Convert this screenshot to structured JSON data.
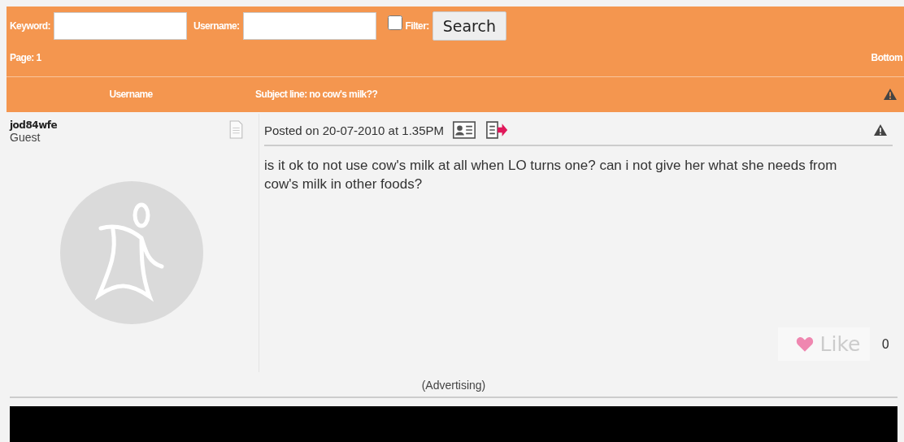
{
  "search_bar": {
    "keyword_label": "Keyword:",
    "username_label": "Username:",
    "filter_label": "Filter:",
    "filter_checked": false,
    "search_button": "Search"
  },
  "pagination": {
    "page": "Page: 1",
    "bottom_link": "Bottom"
  },
  "table_header": {
    "username_column": "Username",
    "subject": "Subject line: no cow's milk??"
  },
  "post": {
    "username": "jod84wfe",
    "role": "Guest",
    "posted": "Posted on 20-07-2010 at 1.35PM",
    "body": "is it ok to not use cow's milk at all when LO turns one? can i not give her what she needs from cow's milk  in other foods?",
    "like_button": "Like",
    "like_count": "0"
  },
  "advertising_label": "(Advertising)"
}
